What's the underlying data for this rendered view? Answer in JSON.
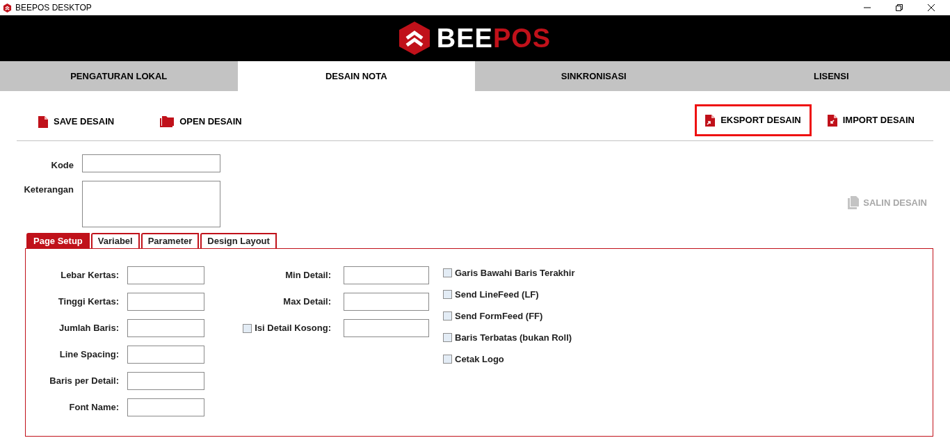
{
  "window": {
    "title": "BEEPOS DESKTOP"
  },
  "logo": {
    "part_1": "BEE",
    "part_2": "POS"
  },
  "main_tabs": [
    {
      "label": "PENGATURAN LOKAL",
      "selected": false
    },
    {
      "label": "DESAIN NOTA",
      "selected": true
    },
    {
      "label": "SINKRONISASI",
      "selected": false
    },
    {
      "label": "LISENSI",
      "selected": false
    }
  ],
  "toolbar_left": [
    {
      "label": "SAVE DESAIN",
      "kind": "file",
      "highlighted": false
    },
    {
      "label": "OPEN DESAIN",
      "kind": "folder",
      "highlighted": false
    }
  ],
  "toolbar_right": [
    {
      "label": "EKSPORT DESAIN",
      "kind": "export",
      "highlighted": true
    },
    {
      "label": "IMPORT DESAIN",
      "kind": "import",
      "highlighted": false
    }
  ],
  "form": {
    "kode_label": "Kode",
    "keterangan_label": "Keterangan"
  },
  "copy_button": {
    "label": "SALIN DESAIN",
    "disabled": true
  },
  "sub_tabs": [
    {
      "label": "Page Setup",
      "selected": true
    },
    {
      "label": "Variabel",
      "selected": false
    },
    {
      "label": "Parameter",
      "selected": false
    },
    {
      "label": "Design Layout",
      "selected": false
    }
  ],
  "page_setup_fields": [
    {
      "label": "Lebar Kertas:"
    },
    {
      "label": "Tinggi Kertas:"
    },
    {
      "label": "Jumlah Baris:"
    },
    {
      "label": "Line Spacing:"
    },
    {
      "label": "Baris per Detail:"
    },
    {
      "label": "Font Name:"
    }
  ],
  "detail_fields": [
    {
      "label": "Min Detail:",
      "kind": "plain"
    },
    {
      "label": "Max Detail:",
      "kind": "plain"
    },
    {
      "label": "Isi Detail Kosong:",
      "kind": "checkbox",
      "checked": false
    }
  ],
  "options": [
    {
      "label": "Garis Bawahi Baris Terakhir",
      "checked": false
    },
    {
      "label": "Send LineFeed (LF)",
      "checked": false
    },
    {
      "label": "Send FormFeed (FF)",
      "checked": false
    },
    {
      "label": "Baris Terbatas (bukan Roll)",
      "checked": false
    },
    {
      "label": "Cetak Logo",
      "checked": false
    }
  ]
}
